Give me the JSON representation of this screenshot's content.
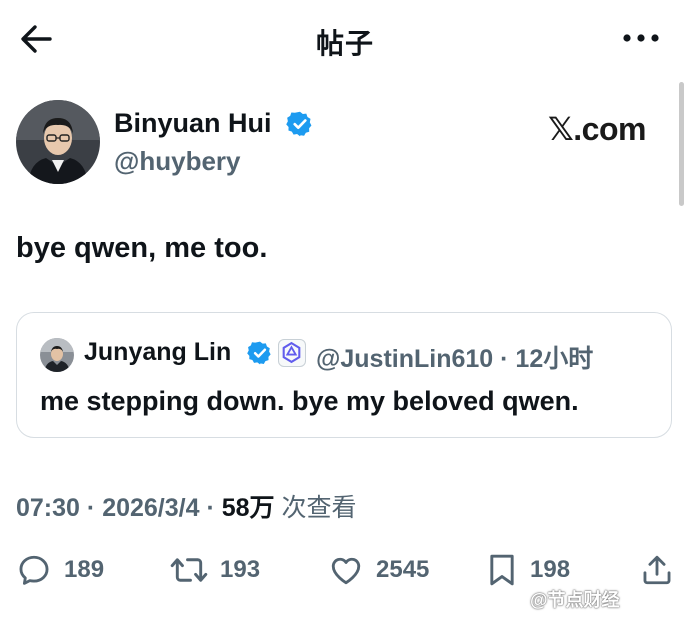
{
  "topbar": {
    "title": "帖子",
    "back_icon": "arrow-left-icon",
    "more_icon": "more-horizontal-icon"
  },
  "author": {
    "name": "Binyuan Hui",
    "handle": "@huybery",
    "verified": true
  },
  "source_label": "𝕏.com",
  "tweet": {
    "text": "bye qwen, me too."
  },
  "quoted_tweet": {
    "name": "Junyang Lin",
    "verified": true,
    "handle_time": "@JustinLin610 · 12小时",
    "text": "me stepping down. bye my beloved qwen."
  },
  "meta": {
    "time": "07:30",
    "date": "2026/3/4",
    "views": "58万",
    "views_label": "次查看"
  },
  "actions": {
    "replies": "189",
    "retweets": "193",
    "likes": "2545",
    "bookmarks": "198"
  },
  "watermark": "@节点财经",
  "colors": {
    "verified_blue": "#1d9bf0",
    "secondary_text": "#536471",
    "primary_text": "#0f1419"
  }
}
